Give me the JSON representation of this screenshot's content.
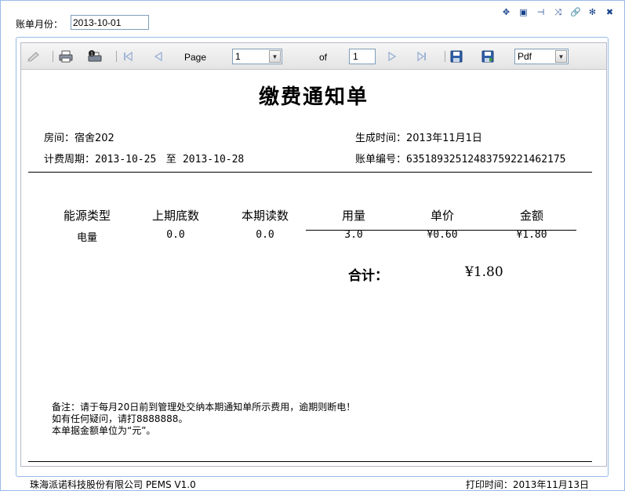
{
  "header": {
    "month_label": "账单月份：",
    "month_value": "2013-10-01"
  },
  "window_tools": [
    {
      "name": "move-icon",
      "glyph": "✥"
    },
    {
      "name": "restore-icon",
      "glyph": "▣"
    },
    {
      "name": "pin-icon",
      "glyph": "⊣"
    },
    {
      "name": "shuffle-icon",
      "glyph": "⤨"
    },
    {
      "name": "link-icon",
      "glyph": "🔗"
    },
    {
      "name": "gear-icon",
      "glyph": "✻"
    },
    {
      "name": "close-icon",
      "glyph": "✖"
    }
  ],
  "toolbar": {
    "page_label": "Page",
    "page_value": "1",
    "of_label": "of",
    "total_pages": "1",
    "format_value": "Pdf"
  },
  "report": {
    "title": "缴费通知单",
    "room_label": "房间：",
    "room_value": "宿舍202",
    "generated_label": "生成时间：",
    "generated_value": "2013年11月1日",
    "period_label": "计费周期：",
    "period_start": "2013-10-25",
    "period_to": "至",
    "period_end": "2013-10-28",
    "bill_no_label": "账单编号：",
    "bill_no_value": "63518932512483759221462175",
    "columns": [
      "能源类型",
      "上期底数",
      "本期读数",
      "用量",
      "单价",
      "金额"
    ],
    "rows": [
      {
        "type": "电量",
        "prev": "0.0",
        "curr": "0.0",
        "usage": "3.0",
        "price": "¥0.60",
        "amount": "¥1.80"
      }
    ],
    "total_label": "合计：",
    "total_value": "¥1.80",
    "notes": [
      "备注：请于每月20日前到管理处交纳本期通知单所示费用，逾期则断电！",
      "如有任何疑问，请打8888888。",
      "本单据金额单位为“元”。"
    ],
    "company": "珠海派诺科技股份有限公司  PEMS V1.0",
    "print_time": "打印时间：2013年11月13日"
  }
}
